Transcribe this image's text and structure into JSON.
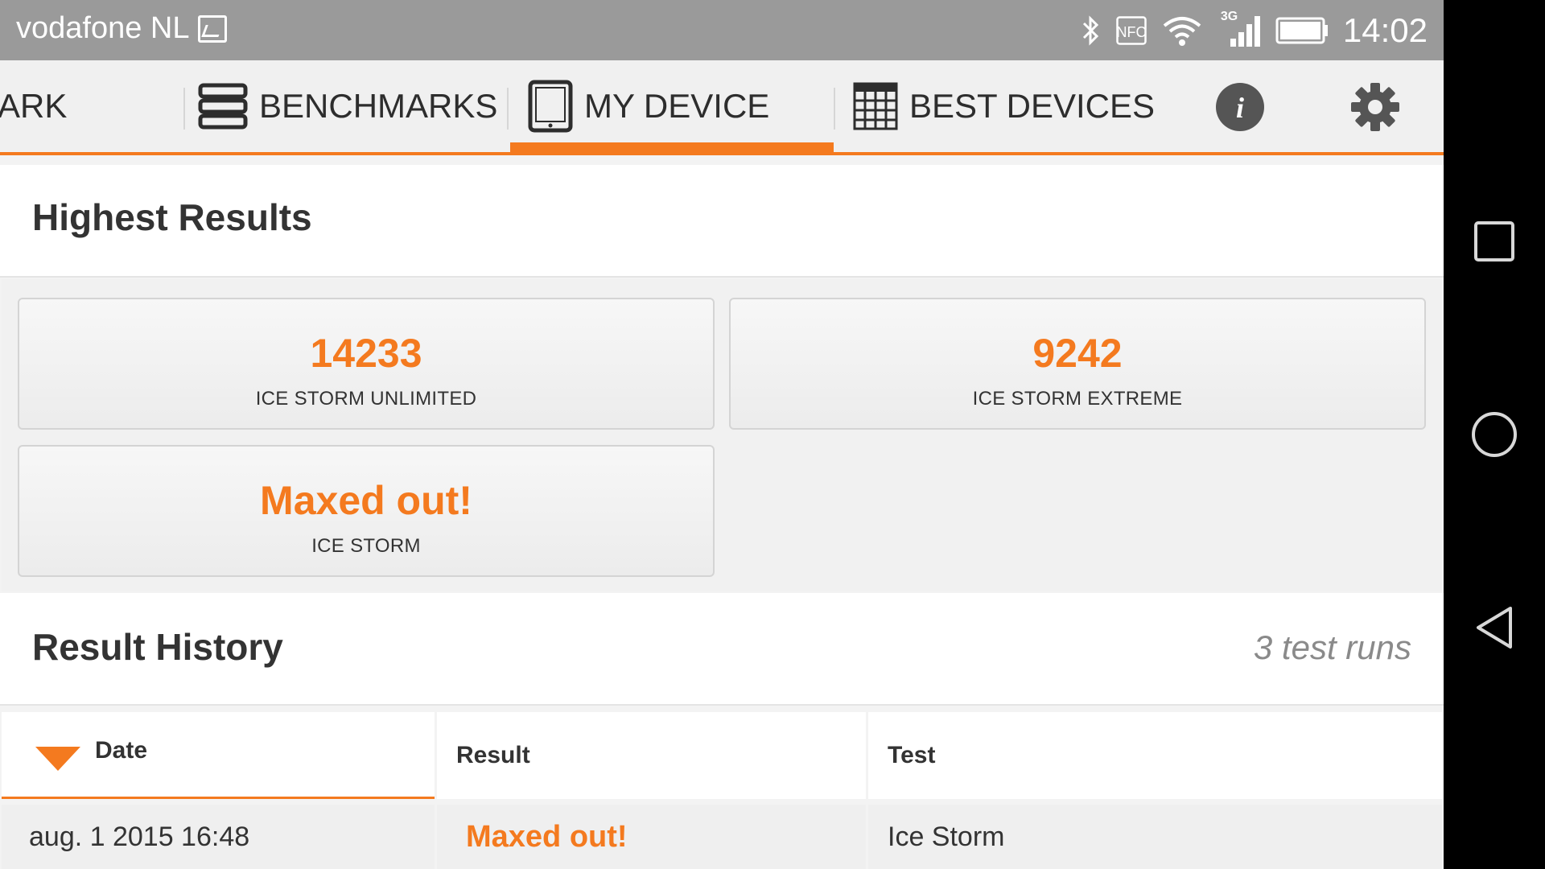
{
  "status_bar": {
    "carrier": "vodafone NL",
    "network": "3G",
    "nfc_label": "NFC",
    "time": "14:02"
  },
  "tabs": [
    {
      "label": "MARK",
      "partial_label": "IARK",
      "active": false
    },
    {
      "label": "BENCHMARKS",
      "active": false
    },
    {
      "label": "MY DEVICE",
      "active": true
    },
    {
      "label": "BEST DEVICES",
      "active": false
    }
  ],
  "highest_results": {
    "title": "Highest Results",
    "cards": [
      {
        "score": "14233",
        "name": "ICE STORM UNLIMITED"
      },
      {
        "score": "9242",
        "name": "ICE STORM EXTREME"
      },
      {
        "score": "Maxed out!",
        "name": "ICE STORM"
      }
    ]
  },
  "result_history": {
    "title": "Result History",
    "count_text": "3 test runs",
    "columns": [
      "Date",
      "Result",
      "Test"
    ],
    "sorted_column": "Date",
    "rows": [
      {
        "date": "aug. 1 2015 16:48",
        "result": "Maxed out!",
        "test": "Ice Storm"
      }
    ]
  },
  "colors": {
    "accent": "#f47a1f",
    "status_bar": "#9a9a9a",
    "text": "#333333",
    "muted": "#8a8a8a"
  }
}
